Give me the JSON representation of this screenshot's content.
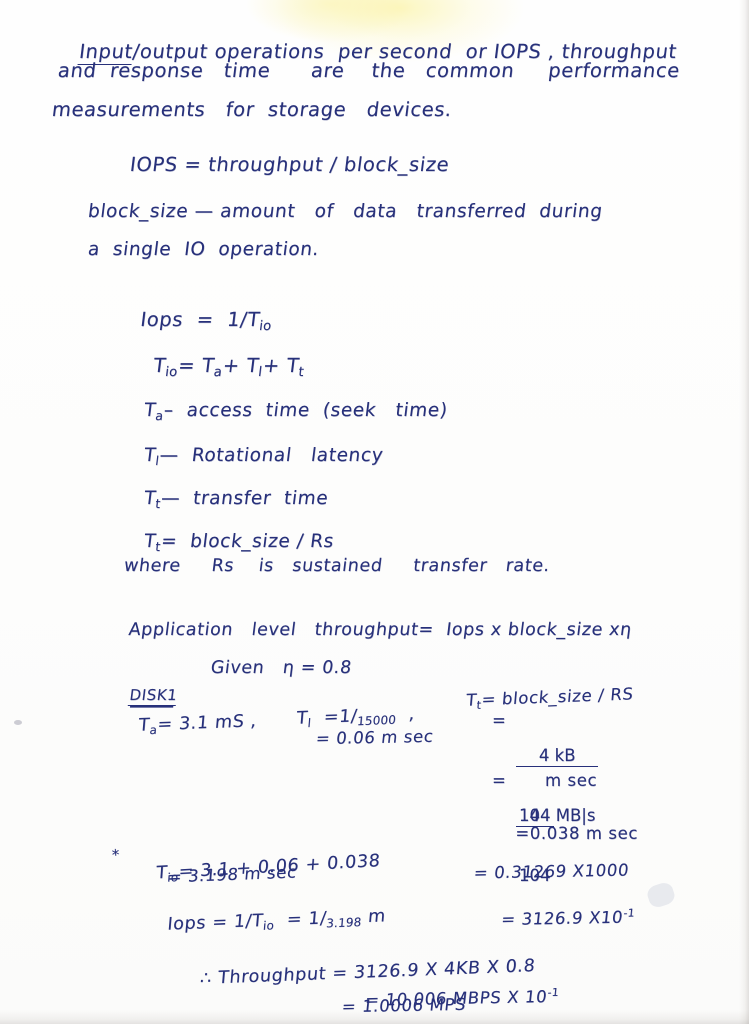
{
  "document": {
    "kind": "handwritten-notes",
    "subject": "Storage device performance: IOPS, throughput, response time",
    "ink_color": "#27307a",
    "paper_color": "#fdfdfc",
    "highlight_color": "#faf08c"
  },
  "intro": {
    "line1": "Input/output operations  per second  or IOPS , throughput",
    "line1_underlined_word": "Input",
    "line2": "and  response   time      are    the   common     performance",
    "line3": "measurements   for  storage   devices."
  },
  "formulas": {
    "iops_def": "IOPS = throughput / block_size",
    "blocksize_def_line1": "block_size — amount   of   data   transferred  during",
    "blocksize_def_line2": "a  single  IO  operation.",
    "iops_recip_label": "Iops",
    "iops_recip_eq": "=",
    "iops_recip_value_num": "1",
    "iops_recip_value_den": "T",
    "iops_recip_value_den_sub": "io",
    "tio_sum": "T",
    "tio_sum_sub": "io",
    "tio_sum_rhs": "= T",
    "tio_sum_rhs_a": "a",
    "tio_sum_rhs_plus1": "+ T",
    "tio_sum_rhs_l": "l",
    "tio_sum_rhs_plus2": "+ T",
    "tio_sum_rhs_t": "t"
  },
  "definitions": [
    {
      "symbol": "T",
      "subscript": "a",
      "text": "–  access  time  (seek   time)"
    },
    {
      "symbol": "T",
      "subscript": "l",
      "text": "—  Rotational   latency"
    },
    {
      "symbol": "T",
      "subscript": "t",
      "text": "—  transfer  time"
    }
  ],
  "tt_formula": {
    "symbol": "T",
    "subscript": "t",
    "text": "=  block_size / Rs"
  },
  "rs_note": "where     Rs    is   sustained     transfer   rate.",
  "app_throughput": {
    "label": "Application   level   throughput",
    "equals": "=  Iops x block_size x",
    "eta": "η"
  },
  "given": {
    "label": "Given",
    "value": "η = 0.8"
  },
  "disk": {
    "title": "DISK1",
    "ta_symbol": "T",
    "ta_sub": "a",
    "ta_value": "= 3.1 mS ,",
    "tl_symbol": "T",
    "tl_sub": "l",
    "tl_eq": "=",
    "tl_num": "1",
    "tl_den": "15000",
    "tl_comma": ",",
    "tl_result": "= 0.06 m sec",
    "tt_symbol": "T",
    "tt_sub": "t",
    "tt_eq": "= block_size / RS",
    "tt_frac_num": "4 kB",
    "tt_frac_den": "104 MB|s",
    "tt_eq2": "=",
    "tt_frac2_num": "4",
    "tt_frac2_den": "104",
    "tt_frac2_unit": "m sec",
    "tt_eq3": "=",
    "tt_result": "0.038 m sec"
  },
  "tio_calc": {
    "marker": "*",
    "symbol": "T",
    "subscript": "io",
    "line1": "= 3.1 + 0.06 + 0.038",
    "line2": "= 3.198 m sec"
  },
  "iops_calc": {
    "label": "Iops",
    "eq1": "=",
    "num1": "1",
    "den1": "T",
    "den1_sub": "io",
    "eq2": "=",
    "num2": "1",
    "den2": "3.198",
    "unit": "m",
    "result1": "= 0.31269 X1000",
    "result2": "= 3126.9 X10",
    "result2_exp": "-1"
  },
  "throughput_calc": {
    "therefore": "∴",
    "label": "Throughput",
    "line1": "= 3126.9 X 4KB X 0.8",
    "line2": "= 10.006 MBPS X 10",
    "line2_exp": "-1",
    "line3": "= 1.0006 MPS"
  }
}
